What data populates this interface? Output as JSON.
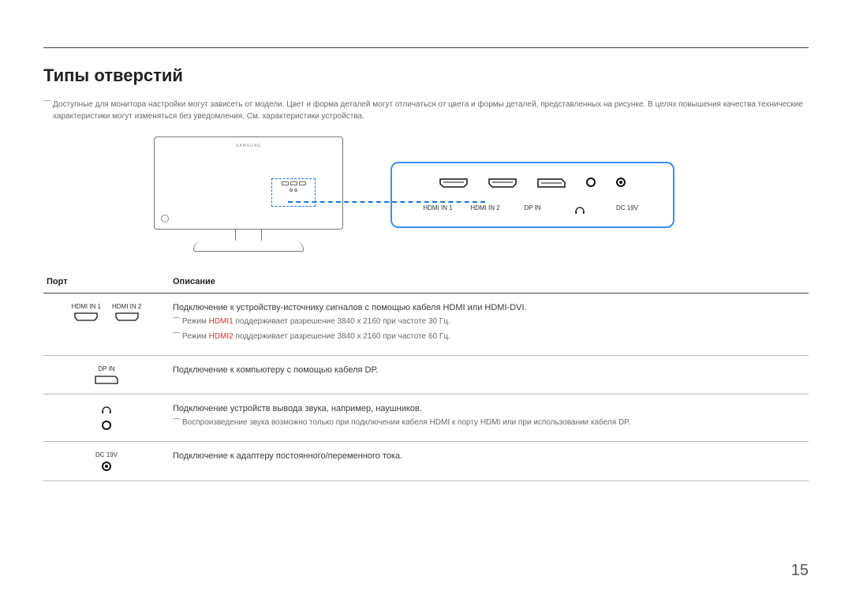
{
  "title": "Типы отверстий",
  "note_top": "Доступные для монитора настройки могут зависеть от модели. Цвет и форма деталей могут отличаться от цвета и формы деталей, представленных на рисунке. В целях повышения качества технические характеристики могут изменяться без уведомления. См. характеристики устройства.",
  "monitor_logo": "SAMSUNG",
  "callout_labels": {
    "hdmi1": "HDMI IN 1",
    "hdmi2": "HDMI IN 2",
    "dp": "DP IN",
    "hp": "🎧",
    "dc": "DC 19V"
  },
  "table": {
    "head_port": "Порт",
    "head_desc": "Описание",
    "rows": {
      "hdmi": {
        "label1": "HDMI IN 1",
        "label2": "HDMI IN 2",
        "desc_main": "Подключение к устройству-источнику сигналов с помощью кабеля HDMI или HDMI-DVI.",
        "note1_prefix": "Режим ",
        "note1_bold": "HDMI1",
        "note1_rest": " поддерживает разрешение 3840 x 2160 при частоте 30 Гц.",
        "note2_prefix": "Режим ",
        "note2_bold": "HDMI2",
        "note2_rest": " поддерживает разрешение 3840 x 2160 при частоте 60 Гц."
      },
      "dp": {
        "label": "DP IN",
        "desc": "Подключение к компьютеру с помощью кабеля DP."
      },
      "hp": {
        "desc_main": "Подключение устройств вывода звука, например, наушников.",
        "note": "Воспроизведение звука возможно только при подключении кабеля HDMI к порту HDMI или при использовании кабеля DP."
      },
      "dc": {
        "label": "DC 19V",
        "desc": "Подключение к адаптеру постоянного/переменного тока."
      }
    }
  },
  "page_number": "15"
}
